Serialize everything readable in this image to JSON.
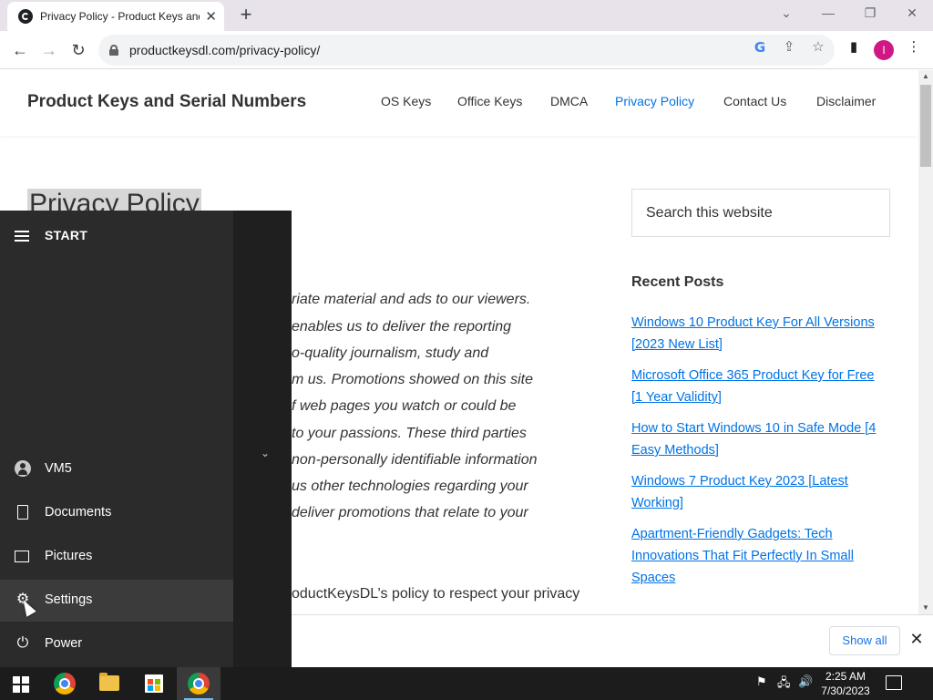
{
  "browser": {
    "tab_title": "Privacy Policy - Product Keys and Serial Numbers",
    "url": "productkeysdl.com/privacy-policy/",
    "profile_initial": "I"
  },
  "site": {
    "title": "Product Keys and Serial Numbers",
    "nav": [
      "OS Keys",
      "Office Keys",
      "DMCA",
      "Privacy Policy",
      "Contact Us",
      "Disclaimer"
    ],
    "active_nav": "Privacy Policy"
  },
  "article": {
    "title": "Privacy Policy",
    "lines": [
      "riate material and ads to our viewers.",
      "enables us to deliver the reporting",
      "o-quality journalism, study and",
      "m us. Promotions showed on this site",
      "f web pages you watch or could be",
      "to your passions. These third parties",
      "non-personally identifiable information",
      "us other technologies regarding your",
      "deliver promotions that relate to your"
    ],
    "last_line": "oductKeysDL’s policy to respect your privacy"
  },
  "sidebar": {
    "search_placeholder": "Search this website",
    "recent_heading": "Recent Posts",
    "recent_posts": [
      "Windows 10 Product Key For All Versions [2023 New List]",
      "Microsoft Office 365 Product Key for Free [1 Year Validity]",
      "How to Start Windows 10 in Safe Mode [4 Easy Methods]",
      "Windows 7 Product Key 2023 [Latest Working]",
      "Apartment-Friendly Gadgets: Tech Innovations That Fit Perfectly In Small Spaces"
    ]
  },
  "downloads": {
    "show_all": "Show all"
  },
  "start_menu": {
    "header": "START",
    "items": [
      "VM5",
      "Documents",
      "Pictures",
      "Settings",
      "Power"
    ]
  },
  "taskbar": {
    "time": "2:25 AM",
    "date": "7/30/2023"
  },
  "colors": {
    "link": "#0073e5",
    "start_bg": "#2b2b2b",
    "taskbar_bg": "#1c1c1c"
  }
}
